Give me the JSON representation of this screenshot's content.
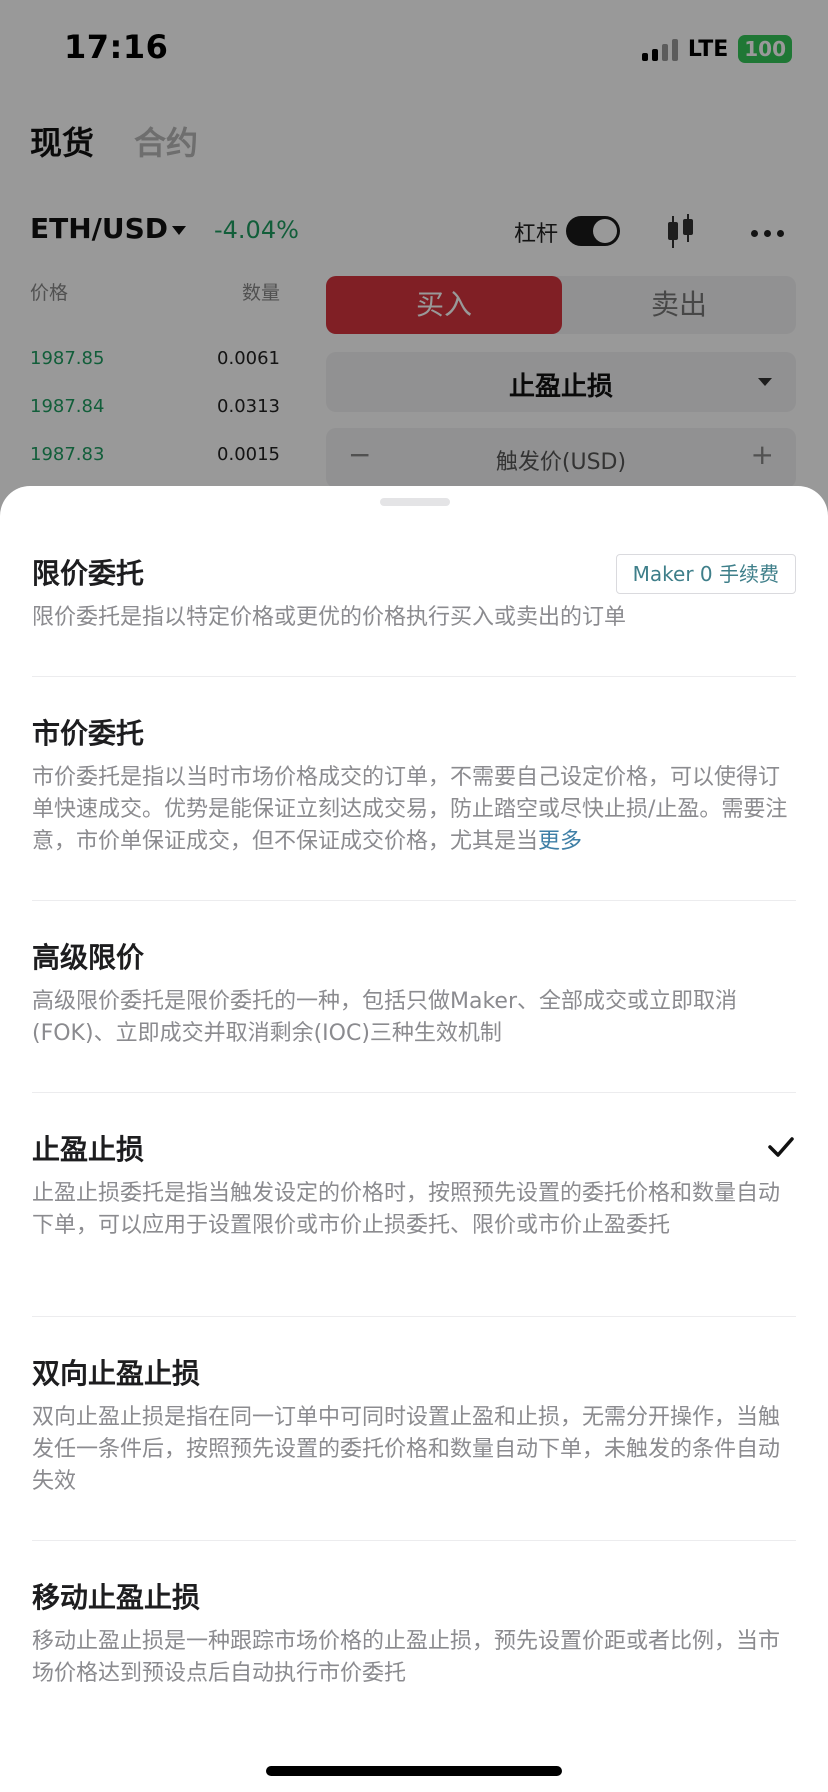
{
  "status_bar": {
    "time": "17:16",
    "network": "LTE",
    "battery": "100"
  },
  "top_tabs": [
    {
      "label": "现货",
      "active": true
    },
    {
      "label": "合约",
      "active": false
    }
  ],
  "pair": {
    "name": "ETH/USD",
    "change": "-4.04%",
    "leverage_label": "杠杆",
    "leverage_enabled": true
  },
  "orderbook": {
    "headers": {
      "price": "价格",
      "amount": "数量"
    },
    "rows": [
      {
        "price": "1987.85",
        "amount": "0.0061"
      },
      {
        "price": "1987.84",
        "amount": "0.0313"
      },
      {
        "price": "1987.83",
        "amount": "0.0015"
      }
    ]
  },
  "trade_panel": {
    "buy_label": "买入",
    "sell_label": "卖出",
    "order_type": "止盈止损",
    "trigger_label": "触发价(USD)",
    "minus": "−",
    "plus": "+"
  },
  "sheet": {
    "options": [
      {
        "title": "限价委托",
        "badge": "Maker 0 手续费",
        "desc": "限价委托是指以特定价格或更优的价格执行买入或卖出的订单"
      },
      {
        "title": "市价委托",
        "desc": "市价委托是指以当时市场价格成交的订单，不需要自己设定价格，可以使得订单快速成交。优势是能保证立刻达成交易，防止踏空或尽快止损/止盈。需要注意，市价单保证成交，但不保证成交价格，尤其是当",
        "more": "更多"
      },
      {
        "title": "高级限价",
        "desc": "高级限价委托是限价委托的一种，包括只做Maker、全部成交或立即取消(FOK)、立即成交并取消剩余(IOC)三种生效机制"
      },
      {
        "title": "止盈止损",
        "selected": true,
        "desc": "止盈止损委托是指当触发设定的价格时，按照预先设置的委托价格和数量自动下单，可以应用于设置限价或市价止损委托、限价或市价止盈委托"
      },
      {
        "title": "双向止盈止损",
        "desc": "双向止盈止损是指在同一订单中可同时设置止盈和止损，无需分开操作，当触发任一条件后，按照预先设置的委托价格和数量自动下单，未触发的条件自动失效"
      },
      {
        "title": "移动止盈止损",
        "desc": "移动止盈止损是一种跟踪市场价格的止盈止损，预先设置价距或者比例，当市场价格达到预设点后自动执行市价委托"
      }
    ]
  },
  "colors": {
    "up_green": "#1f9d62",
    "buy_red": "#d5353f",
    "link_blue": "#3f7fa6"
  }
}
